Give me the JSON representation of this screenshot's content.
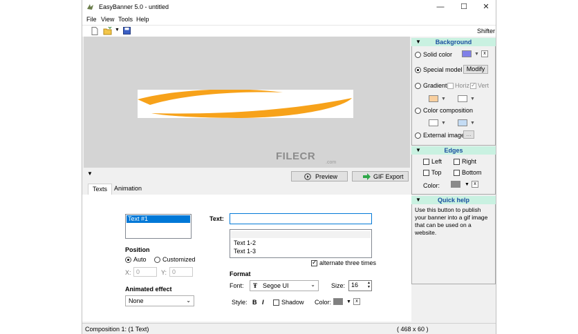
{
  "window": {
    "title": "EasyBanner 5.0 - untitled",
    "minimize": "—",
    "maximize": "☐",
    "close": "✕"
  },
  "menu": {
    "file": "File",
    "view": "View",
    "tools": "Tools",
    "help": "Help",
    "shifter": "Shifter"
  },
  "watermark": {
    "brand": "FILECR",
    "domain": ".com"
  },
  "background_panel": {
    "title": "Background",
    "solid_color": "Solid color",
    "special_model": "Special model",
    "modify": "Modify",
    "gradient": "Gradient",
    "horiz": "Horiz",
    "vert": "Vert",
    "color_composition": "Color composition",
    "external_image": "External image",
    "browse": "...",
    "clear": "x",
    "selected": "special_model",
    "colors": {
      "solid": "#8080e8",
      "gradient_start": "#f8cf9f",
      "gradient_end": "#ffffff",
      "composition_start": "#ffffff",
      "composition_end": "#c4dcf4"
    }
  },
  "edges_panel": {
    "title": "Edges",
    "left": "Left",
    "right": "Right",
    "top": "Top",
    "bottom": "Bottom",
    "color_label": "Color:",
    "clear": "x",
    "color": "#8a8a8a"
  },
  "quick_help": {
    "title": "Quick help",
    "text": "Use this button to publish your banner into a gif image that can be used on a website."
  },
  "preview_bar": {
    "collapse": "▼",
    "preview": "Preview",
    "gif_export": "GIF Export"
  },
  "tabs": [
    "Texts",
    "Animation"
  ],
  "texts_tab": {
    "text_list": [
      "Text #1"
    ],
    "position_label": "Position",
    "auto": "Auto",
    "customized": "Customized",
    "x_label": "X:",
    "x_value": "0",
    "y_label": "Y:",
    "y_value": "0",
    "animated_effect_label": "Animated effect",
    "animated_effect_value": "None",
    "text_label": "Text:",
    "text_value": "",
    "text_lines": [
      "",
      "Text 1-2",
      "Text 1-3"
    ],
    "alternate": "alternate three times",
    "format_label": "Format",
    "font_label": "Font:",
    "font_value": "Segoe UI",
    "size_label": "Size:",
    "size_value": "16",
    "style_label": "Style:",
    "bold_btn": "B",
    "italic_btn": "I",
    "shadow": "Shadow",
    "color_label": "Color:",
    "clear": "x",
    "text_color": "#808080"
  },
  "status": {
    "left": "Composition 1:  (1 Text)",
    "right": "( 468 x 60 )"
  },
  "icons": [
    "app-logo-icon",
    "new-file-icon",
    "open-folder-icon",
    "save-icon",
    "play-icon",
    "gif-export-icon",
    "font-type-icon"
  ]
}
